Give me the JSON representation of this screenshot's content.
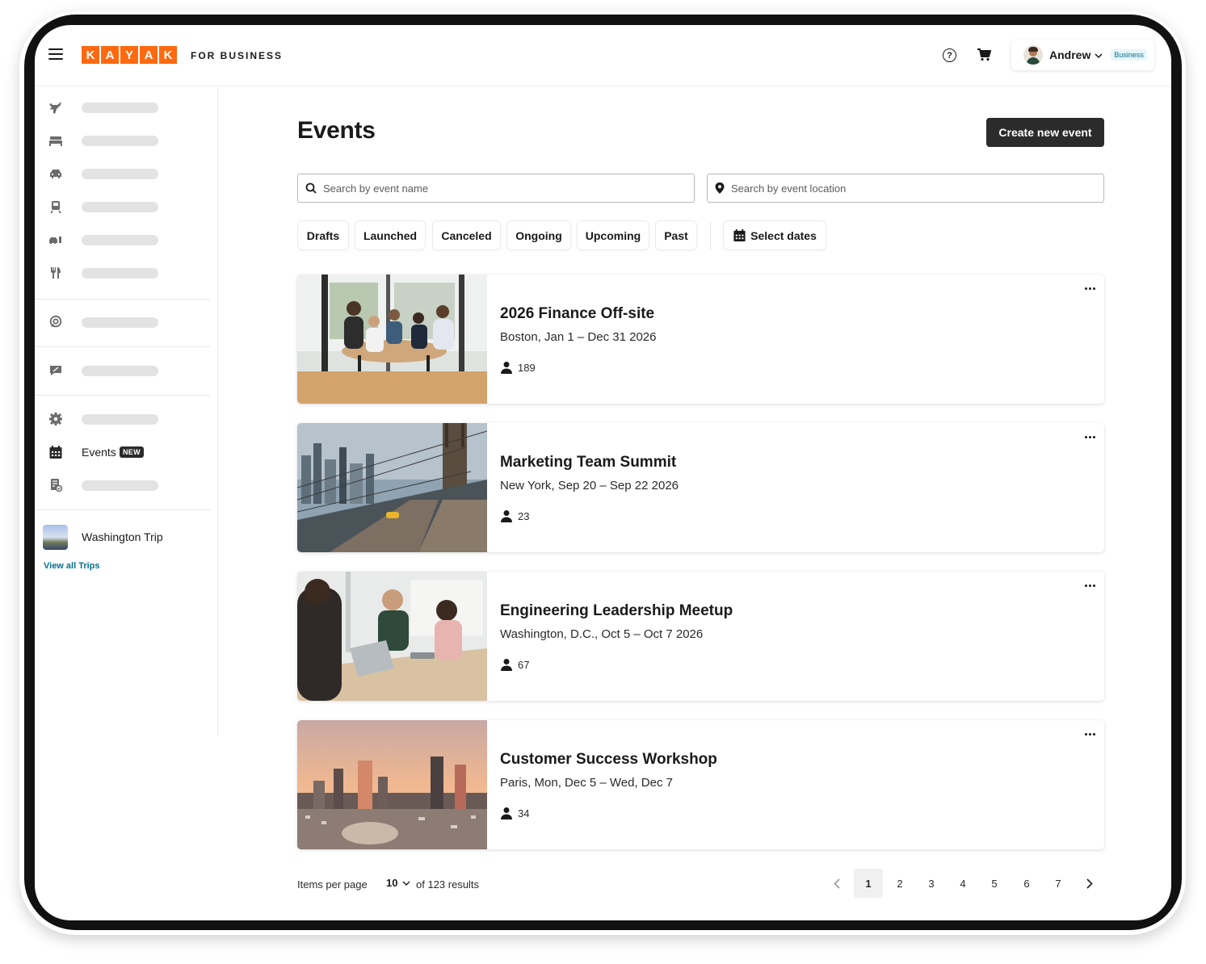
{
  "brand": {
    "logo_letters": [
      "K",
      "A",
      "Y",
      "A",
      "K"
    ],
    "subtitle": "FOR BUSINESS",
    "accent_color": "#ff690f"
  },
  "header": {
    "help_icon": "question-circle-icon",
    "cart_icon": "cart-icon",
    "user_name": "Andrew",
    "user_badge": "Business"
  },
  "sidebar": {
    "items": [
      {
        "icon": "flight-icon"
      },
      {
        "icon": "hotel-icon"
      },
      {
        "icon": "car-icon"
      },
      {
        "icon": "train-icon"
      },
      {
        "icon": "car-fuel-icon"
      },
      {
        "icon": "restaurant-icon"
      },
      {
        "icon": "explore-icon"
      },
      {
        "icon": "feedback-icon"
      },
      {
        "icon": "settings-icon"
      },
      {
        "icon": "calendar-icon",
        "label": "Events",
        "badge": "NEW"
      },
      {
        "icon": "document-check-icon"
      }
    ],
    "trip_name": "Washington Trip",
    "view_all_label": "View all Trips"
  },
  "main": {
    "title": "Events",
    "create_button": "Create new event",
    "search_name_placeholder": "Search by event name",
    "search_location_placeholder": "Search by event location",
    "filters": [
      "Drafts",
      "Launched",
      "Canceled",
      "Ongoing",
      "Upcoming",
      "Past"
    ],
    "date_filter": "Select dates"
  },
  "events": [
    {
      "title": "2026 Finance Off-site",
      "subtitle": "Boston, Jan 1 – Dec 31 2026",
      "attendees": "189"
    },
    {
      "title": "Marketing Team Summit",
      "subtitle": "New York, Sep 20 – Sep 22 2026",
      "attendees": "23"
    },
    {
      "title": "Engineering Leadership Meetup",
      "subtitle": "Washington, D.C., Oct 5 – Oct 7 2026",
      "attendees": "67"
    },
    {
      "title": "Customer Success Workshop",
      "subtitle": "Paris, Mon, Dec 5 – Wed, Dec 7",
      "attendees": "34"
    }
  ],
  "pagination": {
    "items_per_page_label": "Items per page",
    "items_per_page": "10",
    "results_text": "of 123 results",
    "pages": [
      "1",
      "2",
      "3",
      "4",
      "5",
      "6",
      "7"
    ],
    "current_page": "1"
  }
}
